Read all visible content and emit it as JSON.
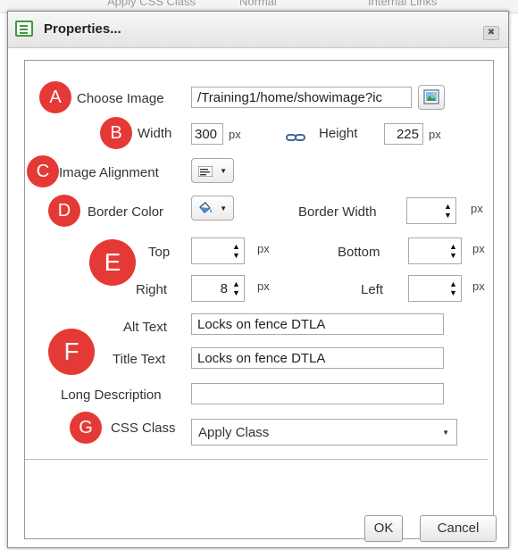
{
  "background_toolbar": {
    "class_text": "Apply CSS Class",
    "style_text": "Normal",
    "links_text": "Internal Links"
  },
  "dialog": {
    "title": "Properties...",
    "close_glyph": "✖"
  },
  "choose_image": {
    "badge": "A",
    "label": "Choose Image",
    "value": "/Training1/home/showimage?ic",
    "browse_icon": "image-picker-icon"
  },
  "size": {
    "badge": "B",
    "width_label": "Width",
    "width_value": "300",
    "width_unit": "px",
    "lock_icon": "chain-link-icon",
    "height_label": "Height",
    "height_value": "225",
    "height_unit": "px"
  },
  "alignment": {
    "badge": "C",
    "label": "Image Alignment",
    "icon": "align-left-icon"
  },
  "border": {
    "badge": "D",
    "color_label": "Border Color",
    "color_icon": "paint-bucket-icon",
    "width_label": "Border Width",
    "width_value": "",
    "unit": "px"
  },
  "margins": {
    "badge": "E",
    "top_label": "Top",
    "top_value": "",
    "bottom_label": "Bottom",
    "bottom_value": "",
    "right_label": "Right",
    "right_value": "8",
    "left_label": "Left",
    "left_value": "",
    "unit": "px"
  },
  "text": {
    "badge": "F",
    "alt_label": "Alt Text",
    "alt_value": "Locks on fence DTLA",
    "title_label": "Title Text",
    "title_value": "Locks on fence DTLA",
    "longdesc_label": "Long Description",
    "longdesc_value": ""
  },
  "css_class": {
    "badge": "G",
    "label": "CSS Class",
    "selected": "Apply Class"
  },
  "buttons": {
    "ok": "OK",
    "cancel": "Cancel"
  },
  "colors": {
    "badge_red": "#e53935",
    "title_icon_green": "#3a9b3a"
  }
}
